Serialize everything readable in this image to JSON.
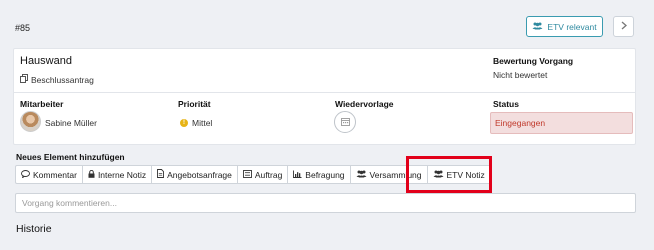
{
  "ticket": {
    "id": "#85",
    "title": "Hauswand",
    "doc_type": "Beschlussantrag"
  },
  "header_buttons": {
    "etv_relevant": "ETV relevant"
  },
  "evaluation": {
    "label": "Bewertung Vorgang",
    "value": "Nicht bewertet"
  },
  "columns": {
    "employee_label": "Mitarbeiter",
    "employee_name": "Sabine Müller",
    "priority_label": "Priorität",
    "priority_value": "Mittel",
    "followup_label": "Wiedervorlage",
    "status_label": "Status",
    "status_value": "Eingegangen"
  },
  "colors": {
    "accent": "#2f8aa0",
    "status_bg": "#f3dede",
    "status_text": "#c0392b",
    "priority": "#e7b416",
    "highlight": "#e2001a"
  },
  "add_element": {
    "title": "Neues Element hinzufügen",
    "tabs": [
      {
        "label": "Kommentar",
        "icon": "comment-icon"
      },
      {
        "label": "Interne Notiz",
        "icon": "lock-icon"
      },
      {
        "label": "Angebotsanfrage",
        "icon": "document-icon"
      },
      {
        "label": "Auftrag",
        "icon": "list-icon"
      },
      {
        "label": "Befragung",
        "icon": "bar-chart-icon"
      },
      {
        "label": "Versammlung",
        "icon": "group-icon"
      },
      {
        "label": "ETV Notiz",
        "icon": "group-icon"
      }
    ]
  },
  "comment": {
    "placeholder": "Vorgang kommentieren..."
  },
  "history": {
    "title": "Historie"
  }
}
